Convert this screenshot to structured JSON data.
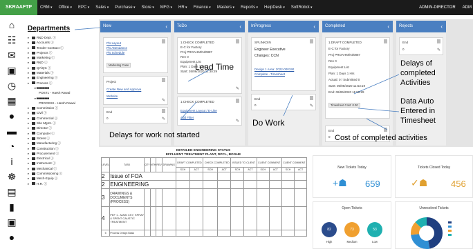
{
  "brand": "SKRAAFTP",
  "top_menu": [
    "CRM",
    "Office",
    "EPC",
    "Sales",
    "Purchase",
    "Store",
    "MFG",
    "HR",
    "Finance",
    "Masters",
    "Reports",
    "HelpDesk",
    "SoftRobot"
  ],
  "admin": [
    "ADMIN-DIRECTOR",
    "ADM"
  ],
  "rail_icons": [
    "home-icon",
    "org-chart-icon",
    "mail-icon",
    "monitor-icon",
    "clock-icon",
    "calendar-icon",
    "users-icon",
    "document-icon",
    "dashboard-icon",
    "info-icon",
    "share-icon",
    "bar-chart-icon",
    "file-icon",
    "coin-icon",
    "chat-icon"
  ],
  "departments": {
    "title": "Departments",
    "items": [
      {
        "label": "R&D Dept. ⓘ",
        "level": 0
      },
      {
        "label": "Accounts ⓘ",
        "level": 0
      },
      {
        "label": "Tender-Contract ⓘ",
        "level": 0
      },
      {
        "label": "Projects ⓘ",
        "level": 0
      },
      {
        "label": "Marketing ⓘ",
        "level": 0
      },
      {
        "label": "R&D ⓘ",
        "level": 0
      },
      {
        "label": "QA/QC ⓘ",
        "level": 0
      },
      {
        "label": "Materials ⓘ",
        "level": 0
      },
      {
        "label": "Engineering ⓘ",
        "level": 0
      },
      {
        "label": "Process ⓘ",
        "level": 0
      },
      {
        "label": "▸ ■■■■■■■■",
        "level": 1
      },
      {
        "label": "POST1 - Harsh Rawal",
        "level": 2
      },
      {
        "label": "▸ ■■■■■■■■",
        "level": 1
      },
      {
        "label": "PROCESS - Harsh Rawal",
        "level": 2
      },
      {
        "label": "Commission ⓘ",
        "level": 0
      },
      {
        "label": "Civil ⓘ",
        "level": 0
      },
      {
        "label": "Commercial ⓘ",
        "level": 0
      },
      {
        "label": "Site Mgmt. ⓘ",
        "level": 0
      },
      {
        "label": "Director ⓘ",
        "level": 0
      },
      {
        "label": "Computer ⓘ",
        "level": 0
      },
      {
        "label": "Stores ⓘ",
        "level": 0
      },
      {
        "label": "Manufacturing ⓘ",
        "level": 0
      },
      {
        "label": "Construction ⓘ",
        "level": 0
      },
      {
        "label": "Procurement ⓘ",
        "level": 0
      },
      {
        "label": "Electrical ⓘ",
        "level": 0
      },
      {
        "label": "Instrument ⓘ",
        "level": 0
      },
      {
        "label": "Mechanical ⓘ",
        "level": 0
      },
      {
        "label": "Commissioning ⓘ",
        "level": 0
      },
      {
        "label": "Mech-Equip ⓘ",
        "level": 0
      },
      {
        "label": "H.R. ⓘ",
        "level": 0
      }
    ]
  },
  "kanban": {
    "columns": [
      {
        "title": "New",
        "cards": [
          {
            "lines": [
              {
                "t": "Pls Layout",
                "link": true
              },
              {
                "t": "Pls Attendance",
                "link": true
              },
              {
                "t": "Pls Schedule",
                "link": true
              },
              {
                "t": "Marketing Case",
                "tag": true
              }
            ]
          },
          {
            "lines": [
              {
                "t": "Project"
              },
              {
                "t": "Create New and Approve",
                "link": true
              },
              {
                "t": "Website",
                "link": true
              }
            ]
          },
          {
            "lines": [
              {
                "t": "End"
              },
              {
                "t": "0"
              }
            ]
          }
        ]
      },
      {
        "title": "ToDo",
        "cards": [
          {
            "lines": [
              {
                "t": "1.CHECK COMPLETED"
              },
              {
                "t": "E-C for Factory"
              },
              {
                "t": "Proj PROAHM/IN/0887"
              },
              {
                "t": "Rev 0"
              },
              {
                "t": "Equipment List"
              },
              {
                "t": "Plan: 1 Days 1 Hrs"
              },
              {
                "t": "Start: 26/06/2020 11:30:29"
              }
            ]
          },
          {
            "lines": [
              {
                "t": "1.CHECK COMPLETED"
              },
              {
                "t": "Equipment Layout / E-Like",
                "link": true
              },
              {
                "t": "Add Filter",
                "link": true
              }
            ]
          }
        ]
      },
      {
        "title": "InProgress",
        "cards": [
          {
            "lines": [
              {
                "t": "SPLINKDIN"
              },
              {
                "t": "Engineer Executive",
                "big": true
              },
              {
                "t": "Changes: CCN",
                "big": true
              },
              {
                "t": ""
              },
              {
                "t": "Design 1 Area: 2022-000190",
                "link": true
              },
              {
                "t": "Complete - Timesheet",
                "link": true
              }
            ]
          },
          {
            "lines": [
              {
                "t": "End"
              },
              {
                "t": "0"
              }
            ]
          }
        ]
      },
      {
        "title": "Completed",
        "cards": [
          {
            "lines": [
              {
                "t": "1.DRAFT COMPLETED"
              },
              {
                "t": "E-C for Factory"
              },
              {
                "t": "Proj PROAHM/IN/0887"
              },
              {
                "t": "Rev 0"
              },
              {
                "t": "Equipment List"
              },
              {
                "t": "Plan: 1 Days 1 Hrs"
              },
              {
                "t": "Actual: 0 / Submitted 0"
              },
              {
                "t": "Start: 06/06/2020 11:53:19"
              },
              {
                "t": "End: 06/06/2020 11:59:29"
              },
              {
                "t": "Timesheet Cost: 0.00",
                "tag": true
              }
            ]
          },
          {
            "lines": [
              {
                "t": "End"
              },
              {
                "t": "0"
              }
            ]
          }
        ]
      },
      {
        "title": "Rejects",
        "cards": [
          {
            "lines": [
              {
                "t": "End"
              },
              {
                "t": "0"
              }
            ]
          }
        ]
      }
    ]
  },
  "report": {
    "title1": "DETAILED ENGINEERING STATUS",
    "title2": "EFFLUENT TREATMENT PLANT, DPCL, BOGHE",
    "headers": [
      "LEVEL",
      "TASK",
      "QTY",
      "MTH",
      "REV",
      "DRAWING",
      "DRAFT COMPLETED",
      "CHECK COMPLETED",
      "ISSUED TO CLIENT",
      "CLIENT COMMENT",
      "CLIENT COMMENT"
    ],
    "sub_headers": [
      "SCH",
      "ACT",
      "SCH",
      "ACT",
      "SCH",
      "ACT",
      "SCH",
      "ACT",
      "SCH",
      "ACT"
    ],
    "rows": [
      {
        "level": "2",
        "task": "Issue of FOA"
      },
      {
        "level": "2",
        "task": "ENGINEERING"
      },
      {
        "level": "3",
        "task": "DRAWINGS & DOCUMENTS (PROCESS)"
      },
      {
        "level": "4",
        "task": "PEF 1 - MAIN CKY, SPRAY & SPENT CAUSTIC TREATMENT"
      },
      {
        "level": "5",
        "task": "Process Design Basis"
      }
    ]
  },
  "widgets": {
    "new_tickets": {
      "title": "New Tickets Today",
      "value": "659",
      "color": "#2f8fd4"
    },
    "tickets_closed": {
      "title": "Tickets Closed Today",
      "value": "456",
      "color": "#e0a030"
    },
    "open_tickets": {
      "title": "Open Tickets",
      "items": [
        {
          "label": "High",
          "value": "82",
          "color": "#2b4c8c"
        },
        {
          "label": "Medium",
          "value": "73",
          "color": "#f0a030"
        },
        {
          "label": "Low",
          "value": "53",
          "color": "#1fb0b0"
        }
      ]
    },
    "unresolved": {
      "title": "Unresolved Tickets"
    }
  },
  "annotations": {
    "lead_time": "Lead Time",
    "delays_not_started": "Delays for work not started",
    "do_work": "Do Work",
    "delays_completed": [
      "Delays of",
      "completed",
      "Activities"
    ],
    "data_auto": [
      "Data Auto",
      "Entered in",
      "Timesheet"
    ],
    "cost_completed": "Cost of completed activities"
  }
}
